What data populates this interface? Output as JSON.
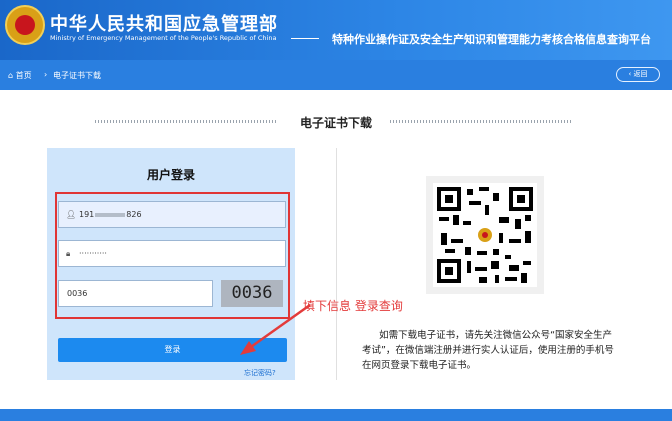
{
  "header": {
    "title": "中华人民共和国应急管理部",
    "title_en": "Ministry of Emergency Management of the People's Republic of China",
    "subtitle": "特种作业操作证及安全生产知识和管理能力考核合格信息查询平台"
  },
  "breadcrumb": {
    "home": "首页",
    "separator": "›",
    "current": "电子证书下载",
    "back_label": "返回"
  },
  "page": {
    "section_title": "电子证书下载"
  },
  "login": {
    "title": "用户登录",
    "username_prefix": "191",
    "username_suffix": "826",
    "password_mask": "···········",
    "captcha_input": "0036",
    "captcha_image_text": "0036",
    "submit_label": "登录",
    "forgot_label": "忘记密码?"
  },
  "annotation": {
    "text": "填下信息 登录查询",
    "color": "#e33b3b"
  },
  "info": {
    "description": "如需下载电子证书，请先关注微信公众号“国家安全生产考试”，在微信端注册并进行实人认证后，使用注册的手机号在网页登录下载电子证书。"
  },
  "colors": {
    "header": "#1a67c9",
    "nav": "#2a7fe0",
    "login_panel": "#cfe5fb",
    "button": "#1c8aef",
    "highlight": "#e03535"
  },
  "icons": {
    "home": "home-icon",
    "user": "user-icon",
    "lock": "lock-icon",
    "back": "back-icon",
    "emblem": "national-emblem-icon"
  }
}
